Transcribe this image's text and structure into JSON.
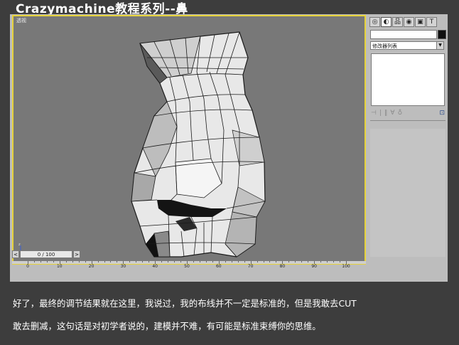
{
  "title": "Crazymachine教程系列--鼻",
  "viewport": {
    "label": "透视"
  },
  "command_panel": {
    "tabs": [
      {
        "name": "create-tab",
        "glyph": "◎"
      },
      {
        "name": "modify-tab",
        "glyph": "◐"
      },
      {
        "name": "hierarchy-tab",
        "glyph": "品"
      },
      {
        "name": "motion-tab",
        "glyph": "◉"
      },
      {
        "name": "display-tab",
        "glyph": "▣"
      },
      {
        "name": "utilities-tab",
        "glyph": "T"
      }
    ],
    "modifier_list": "修改器列表",
    "stack_tools": [
      "⊣",
      "|",
      "‖",
      "∀",
      "♁",
      "⊡"
    ],
    "object_color": "#111111"
  },
  "timeline": {
    "frame": "0 / 100",
    "prev": "<",
    "next": ">"
  },
  "track": {
    "ticks": [
      "0",
      "10",
      "20",
      "30",
      "40",
      "50",
      "60",
      "70",
      "80",
      "90",
      "100"
    ]
  },
  "caption": {
    "line1": "好了，最终的调节结果就在这里，我说过，我的布线并不一定是标准的，但是我敢去CUT",
    "line2": "敢去删减，这句话是对初学者说的，建模并不难，有可能是标准束缚你的思维。"
  }
}
